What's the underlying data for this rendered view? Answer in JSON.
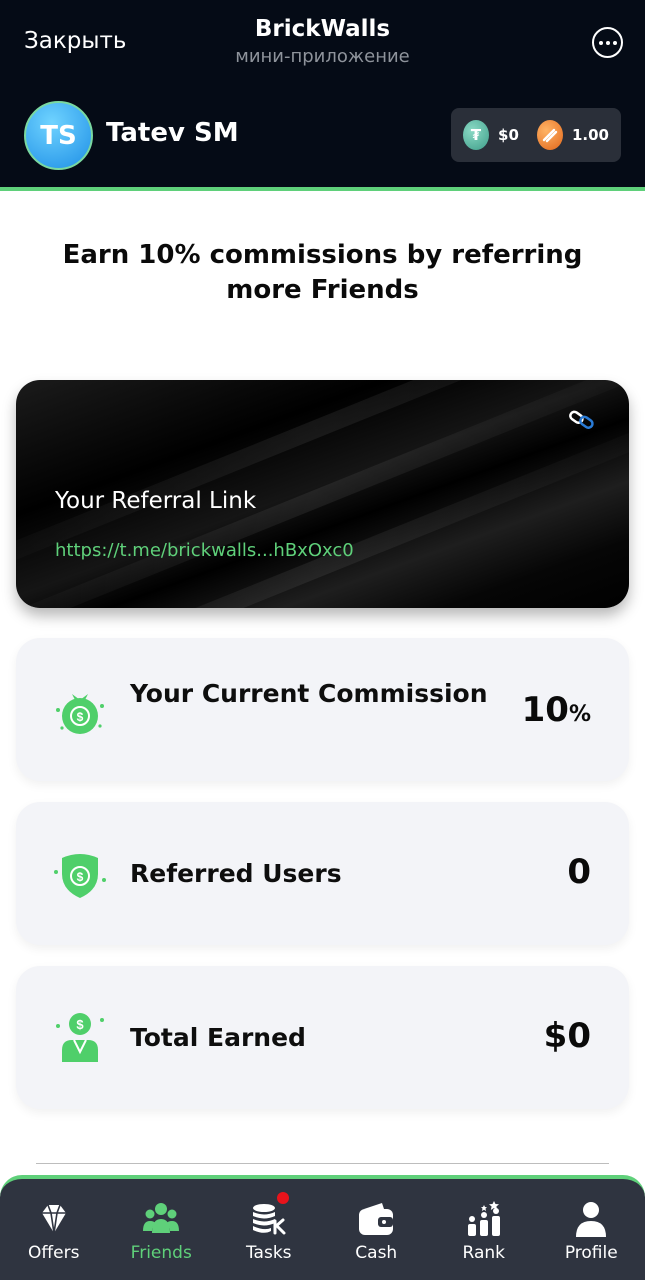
{
  "header": {
    "close_label": "Закрыть",
    "title": "BrickWalls",
    "subtitle": "мини-приложение"
  },
  "user": {
    "initials": "TS",
    "name": "Tatev SM"
  },
  "balance": {
    "usdt": "$0",
    "bricks": "1.00"
  },
  "headline": "Earn 10% commissions by referring more Friends",
  "referral": {
    "title": "Your Referral Link",
    "url": "https://t.me/brickwalls...hBxOxc0"
  },
  "stats": {
    "commission_label": "Your Current Commission",
    "commission_value": "10",
    "commission_unit": "%",
    "referred_label": "Referred Users",
    "referred_value": "0",
    "earned_label": "Total Earned",
    "earned_value": "$0"
  },
  "nav": [
    {
      "label": "Offers",
      "icon": "diamond-icon"
    },
    {
      "label": "Friends",
      "icon": "friends-icon",
      "active": true
    },
    {
      "label": "Tasks",
      "icon": "tasks-icon",
      "badge": true
    },
    {
      "label": "Cash",
      "icon": "wallet-icon"
    },
    {
      "label": "Rank",
      "icon": "rank-icon"
    },
    {
      "label": "Profile",
      "icon": "profile-icon"
    }
  ],
  "colors": {
    "accent_green": "#5fd07a",
    "header_bg": "#050b16",
    "nav_bg": "#2f3440"
  }
}
